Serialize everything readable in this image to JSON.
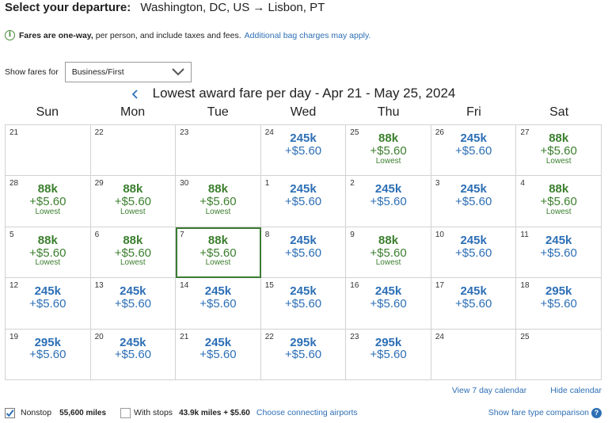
{
  "header": {
    "label": "Select your departure:",
    "route": "Washington, DC, US → Lisbon, PT"
  },
  "notice": {
    "bold": "Fares are one-way,",
    "text": "per person, and include taxes and fees.",
    "link": "Additional bag charges may apply."
  },
  "show_fares": {
    "label": "Show fares for",
    "value": "Business/First"
  },
  "calendar": {
    "title": "Lowest award fare per day - Apr 21 - May 25, 2024",
    "days_of_week": [
      "Sun",
      "Mon",
      "Tue",
      "Wed",
      "Thu",
      "Fri",
      "Sat"
    ],
    "colors": {
      "low": "#3b7f2e",
      "regular": "#2d6fb5",
      "selected_border": "#3c7a34"
    },
    "cells": [
      {
        "day": "21"
      },
      {
        "day": "22"
      },
      {
        "day": "23"
      },
      {
        "day": "24",
        "miles": "245k",
        "fee": "+$5.60",
        "tier": "blue"
      },
      {
        "day": "25",
        "miles": "88k",
        "fee": "+$5.60",
        "tag": "Lowest",
        "tier": "green"
      },
      {
        "day": "26",
        "miles": "245k",
        "fee": "+$5.60",
        "tier": "blue"
      },
      {
        "day": "27",
        "miles": "88k",
        "fee": "+$5.60",
        "tag": "Lowest",
        "tier": "green"
      },
      {
        "day": "28",
        "miles": "88k",
        "fee": "+$5.60",
        "tag": "Lowest",
        "tier": "green"
      },
      {
        "day": "29",
        "miles": "88k",
        "fee": "+$5.60",
        "tag": "Lowest",
        "tier": "green"
      },
      {
        "day": "30",
        "miles": "88k",
        "fee": "+$5.60",
        "tag": "Lowest",
        "tier": "green"
      },
      {
        "day": "1",
        "miles": "245k",
        "fee": "+$5.60",
        "tier": "blue"
      },
      {
        "day": "2",
        "miles": "245k",
        "fee": "+$5.60",
        "tier": "blue"
      },
      {
        "day": "3",
        "miles": "245k",
        "fee": "+$5.60",
        "tier": "blue"
      },
      {
        "day": "4",
        "miles": "88k",
        "fee": "+$5.60",
        "tag": "Lowest",
        "tier": "green"
      },
      {
        "day": "5",
        "miles": "88k",
        "fee": "+$5.60",
        "tag": "Lowest",
        "tier": "green"
      },
      {
        "day": "6",
        "miles": "88k",
        "fee": "+$5.60",
        "tag": "Lowest",
        "tier": "green"
      },
      {
        "day": "7",
        "miles": "88k",
        "fee": "+$5.60",
        "tag": "Lowest",
        "tier": "green",
        "selected": true
      },
      {
        "day": "8",
        "miles": "245k",
        "fee": "+$5.60",
        "tier": "blue"
      },
      {
        "day": "9",
        "miles": "88k",
        "fee": "+$5.60",
        "tag": "Lowest",
        "tier": "green"
      },
      {
        "day": "10",
        "miles": "245k",
        "fee": "+$5.60",
        "tier": "blue"
      },
      {
        "day": "11",
        "miles": "245k",
        "fee": "+$5.60",
        "tier": "blue"
      },
      {
        "day": "12",
        "miles": "245k",
        "fee": "+$5.60",
        "tier": "blue"
      },
      {
        "day": "13",
        "miles": "245k",
        "fee": "+$5.60",
        "tier": "blue"
      },
      {
        "day": "14",
        "miles": "245k",
        "fee": "+$5.60",
        "tier": "blue"
      },
      {
        "day": "15",
        "miles": "245k",
        "fee": "+$5.60",
        "tier": "blue"
      },
      {
        "day": "16",
        "miles": "245k",
        "fee": "+$5.60",
        "tier": "blue"
      },
      {
        "day": "17",
        "miles": "245k",
        "fee": "+$5.60",
        "tier": "blue"
      },
      {
        "day": "18",
        "miles": "295k",
        "fee": "+$5.60",
        "tier": "blue"
      },
      {
        "day": "19",
        "miles": "295k",
        "fee": "+$5.60",
        "tier": "blue"
      },
      {
        "day": "20",
        "miles": "245k",
        "fee": "+$5.60",
        "tier": "blue"
      },
      {
        "day": "21",
        "miles": "245k",
        "fee": "+$5.60",
        "tier": "blue"
      },
      {
        "day": "22",
        "miles": "295k",
        "fee": "+$5.60",
        "tier": "blue"
      },
      {
        "day": "23",
        "miles": "295k",
        "fee": "+$5.60",
        "tier": "blue"
      },
      {
        "day": "24"
      },
      {
        "day": "25"
      }
    ]
  },
  "links": {
    "view_7_day": "View 7 day calendar",
    "hide": "Hide calendar"
  },
  "footer": {
    "nonstop_label": "Nonstop",
    "nonstop_checked": true,
    "nonstop_miles": "55,600 miles",
    "with_stops_label": "With stops",
    "with_stops_checked": false,
    "with_stops_miles": "43.9k miles + $5.60",
    "connecting_link": "Choose connecting airports",
    "comparison_link": "Show fare type comparison"
  }
}
